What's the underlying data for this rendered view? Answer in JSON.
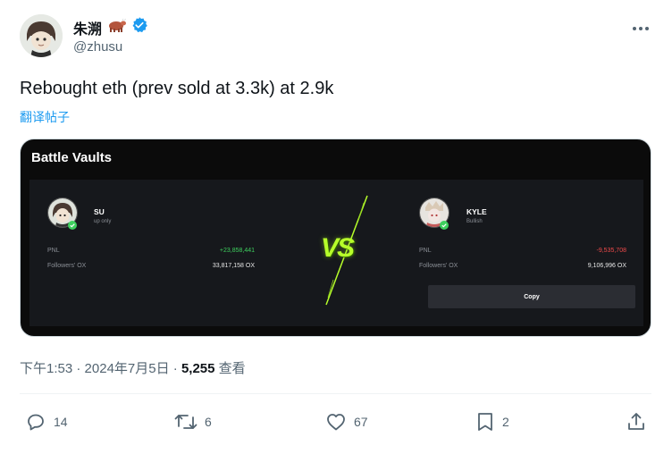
{
  "author": {
    "display_name": "朱溯",
    "handle": "@zhusu"
  },
  "tweet": {
    "text": "Rebought eth (prev sold at 3.3k) at 2.9k",
    "translate_label": "翻译帖子"
  },
  "card": {
    "title": "Battle Vaults",
    "left_player": {
      "name": "SU",
      "subtitle": "up only",
      "pnl_label": "PNL",
      "pnl_value": "+23,858,441",
      "followers_label": "Followers' OX",
      "followers_value": "33,817,158 OX"
    },
    "vs_label": "VS",
    "right_player": {
      "name": "KYLE",
      "subtitle": "Bullish",
      "pnl_label": "PNL",
      "pnl_value": "-9,535,708",
      "followers_label": "Followers' OX",
      "followers_value": "9,106,996 OX",
      "copy_label": "Copy"
    }
  },
  "meta": {
    "time": "下午1:53",
    "sep1": " · ",
    "date": "2024年7月5日",
    "sep2": " · ",
    "views_count": "5,255",
    "views_label": " 查看"
  },
  "actions": {
    "replies": "14",
    "retweets": "6",
    "likes": "67",
    "bookmarks": "2"
  },
  "colors": {
    "accent": "#1d9bf0",
    "verified": "#1d9bf0",
    "positive": "#3ecf5e",
    "negative": "#ef4a4a",
    "vs_green": "#b7ff2a"
  },
  "icons": [
    "verified-badge-icon",
    "cow-emoji-icon",
    "more-icon",
    "reply-icon",
    "retweet-icon",
    "like-icon",
    "bookmark-icon",
    "share-icon"
  ]
}
